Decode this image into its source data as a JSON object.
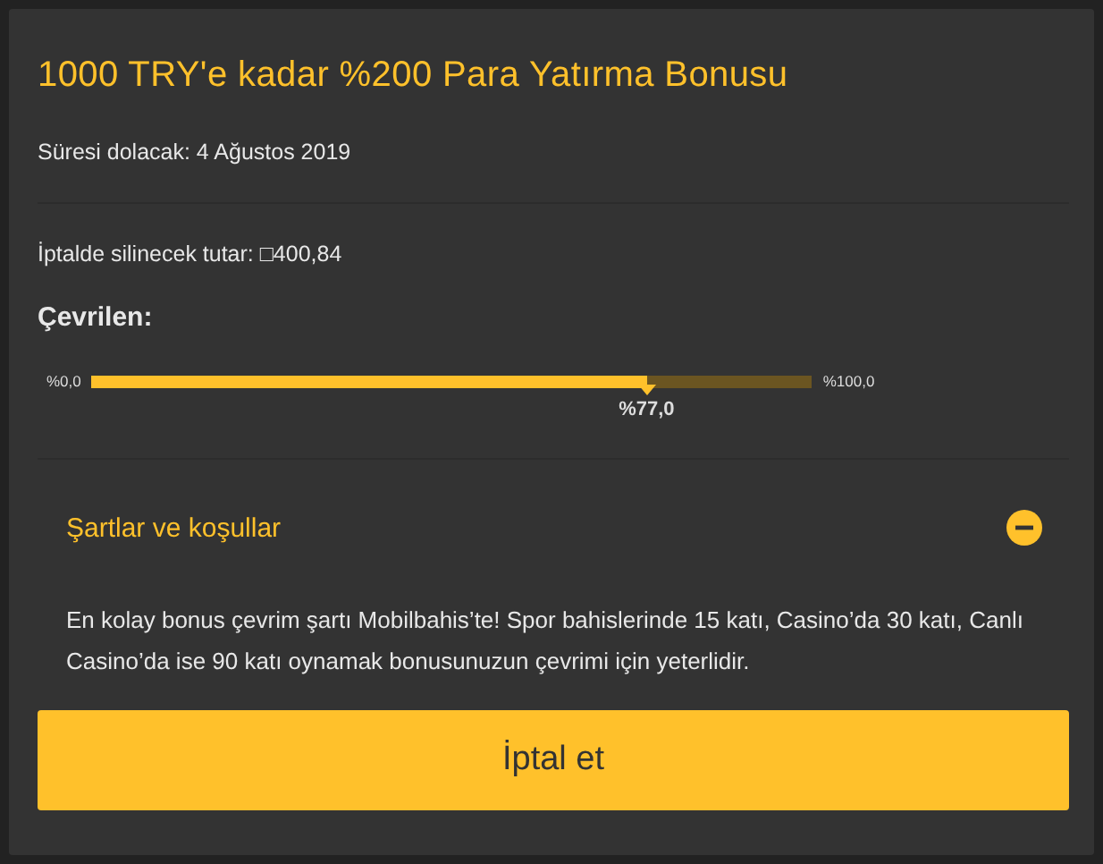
{
  "title": "1000 TRY'e kadar %200 Para Yatırma Bonusu",
  "expiry": "Süresi dolacak: 4 Ağustos 2019",
  "cancel_amount": "İptalde silinecek tutar: □400,84",
  "progress": {
    "label": "Çevrilen:",
    "min_label": "%0,0",
    "max_label": "%100,0",
    "level": 0.77,
    "reading": "%77,0"
  },
  "terms": {
    "title": "Şartlar ve koşullar",
    "expanded": true,
    "text": "En kolay bonus çevrim şartı Mobilbahis’te! Spor bahislerinde 15 katı, Casino’da 30 katı, Canlı Casino’da ise 90 katı oynamak bonusunuzun çevrimi için yeterlidir."
  },
  "button": "İptal et"
}
